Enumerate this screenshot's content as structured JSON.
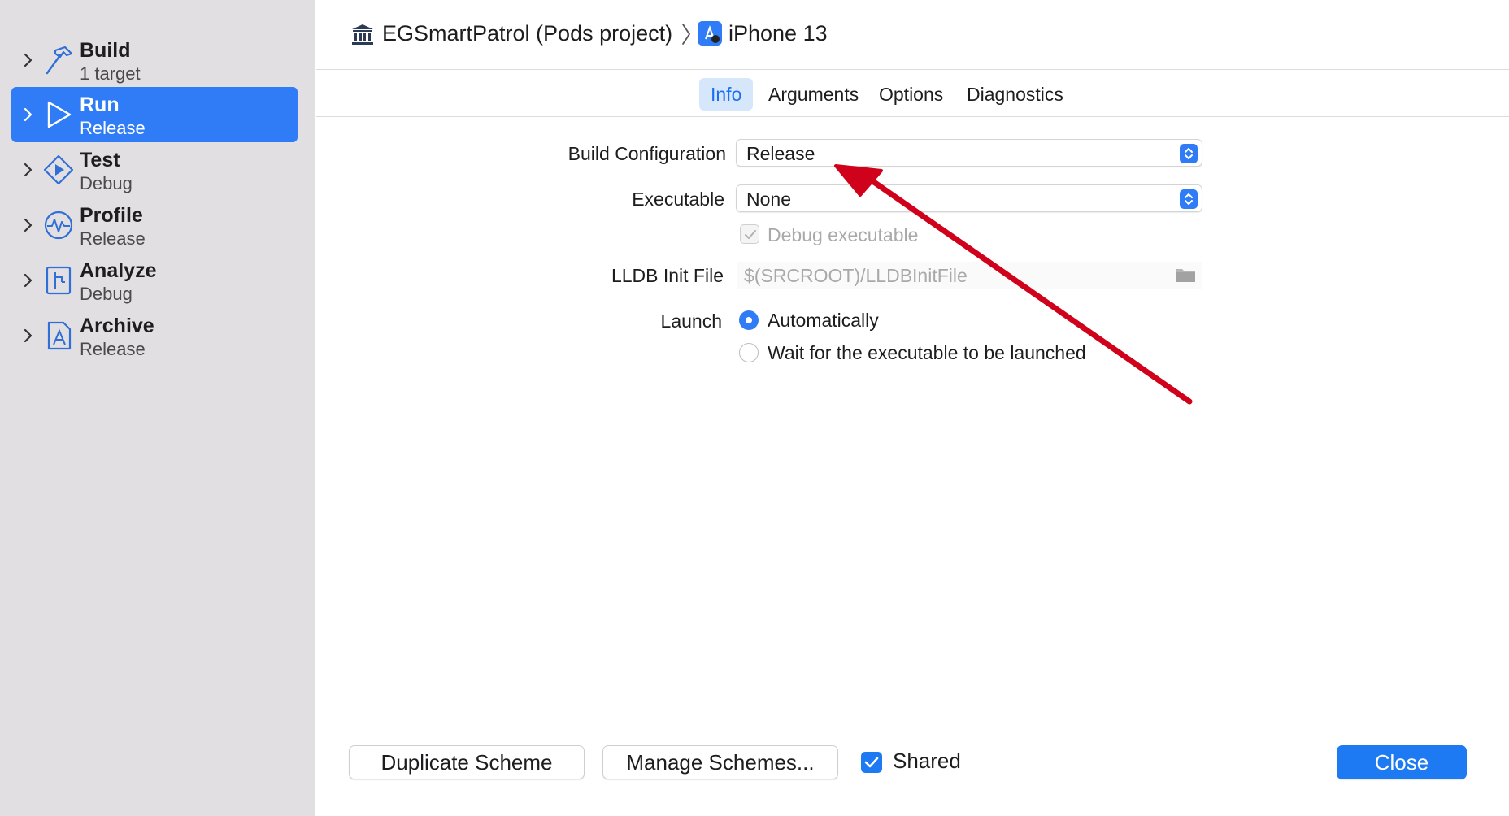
{
  "sidebar": {
    "items": [
      {
        "name": "Build",
        "config": "1 target",
        "icon": "hammer-icon"
      },
      {
        "name": "Run",
        "config": "Release",
        "icon": "play-outline-icon",
        "selected": true
      },
      {
        "name": "Test",
        "config": "Debug",
        "icon": "test-diamond-icon"
      },
      {
        "name": "Profile",
        "config": "Release",
        "icon": "waveform-gauge-icon"
      },
      {
        "name": "Analyze",
        "config": "Debug",
        "icon": "analyze-doc-icon"
      },
      {
        "name": "Archive",
        "config": "Release",
        "icon": "archive-app-icon"
      }
    ]
  },
  "breadcrumb": {
    "project": "EGSmartPatrol (Pods project)",
    "device": "iPhone 13",
    "project_icon": "project-pillars-icon",
    "device_icon": "app-target-icon"
  },
  "tabs": [
    {
      "label": "Info",
      "active": true
    },
    {
      "label": "Arguments"
    },
    {
      "label": "Options"
    },
    {
      "label": "Diagnostics"
    }
  ],
  "form": {
    "build_configuration": {
      "label": "Build Configuration",
      "value": "Release"
    },
    "executable": {
      "label": "Executable",
      "value": "None"
    },
    "debug_executable": {
      "label": "Debug executable",
      "checked": true,
      "disabled": true
    },
    "lldb_init_file": {
      "label": "LLDB Init File",
      "placeholder": "$(SRCROOT)/LLDBInitFile"
    },
    "launch": {
      "label": "Launch",
      "options": [
        {
          "label": "Automatically",
          "selected": true
        },
        {
          "label": "Wait for the executable to be launched",
          "selected": false
        }
      ]
    }
  },
  "footer": {
    "duplicate_label": "Duplicate Scheme",
    "manage_label": "Manage Schemes...",
    "shared_label": "Shared",
    "shared_checked": true,
    "close_label": "Close"
  },
  "colors": {
    "accent": "#2f7cf6",
    "sidebar_bg": "#e2dfe2",
    "annotation_arrow": "#d0021b"
  }
}
